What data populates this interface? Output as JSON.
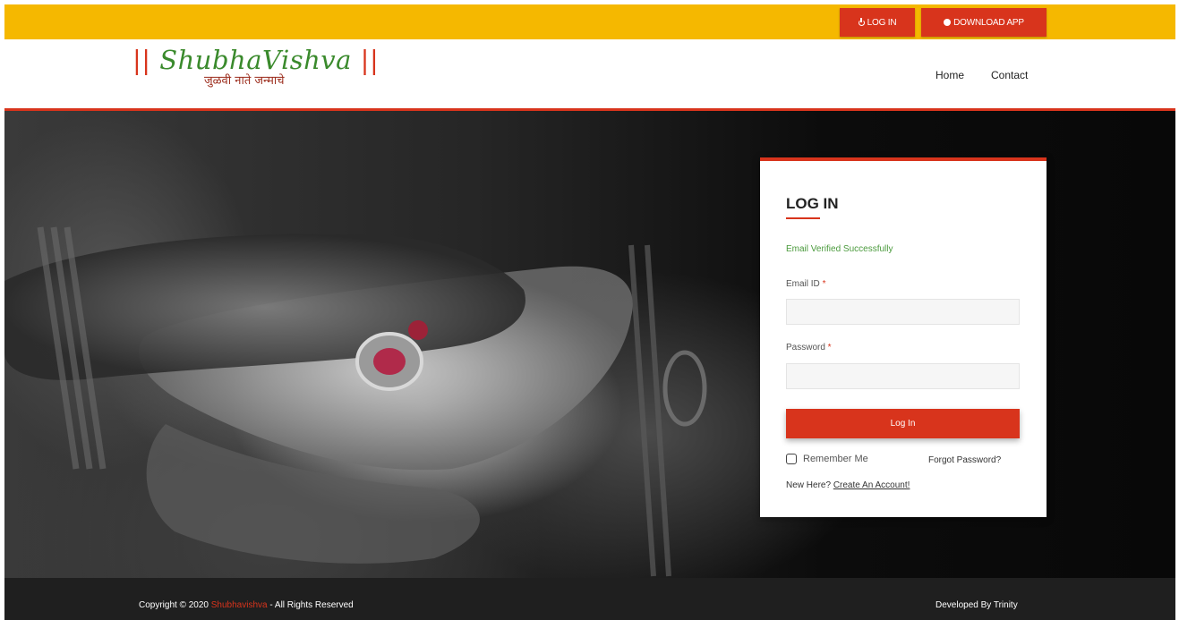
{
  "topbar": {
    "login_label": "LOG IN",
    "download_label": "DOWNLOAD APP",
    "login_icon": "power-icon",
    "download_icon": "android-icon",
    "background_color": "#f5b800",
    "button_color": "#d8341c"
  },
  "header": {
    "logo_prefix": "|| ",
    "logo_name": "ShubhaVishva",
    "logo_suffix": " ||",
    "logo_tagline": "जुळवी नाते जन्माचे",
    "nav": {
      "home": "Home",
      "contact": "Contact"
    }
  },
  "login": {
    "title": "LOG IN",
    "status_message": "Email Verified Successfully",
    "email_label": "Email ID",
    "password_label": "Password",
    "required_mark": " *",
    "email_value": "",
    "password_value": "",
    "submit_label": "Log In",
    "remember_label": "Remember Me",
    "forgot_label": "Forgot Password?",
    "signup_prompt": "New Here? ",
    "signup_link": "Create An Account!"
  },
  "footer": {
    "copyright_prefix": "Copyright © 2020 ",
    "copyright_brand": "Shubhavishva",
    "copyright_suffix": " - All Rights Reserved",
    "developed_by": "Developed By Trinity"
  },
  "colors": {
    "accent": "#d8341c",
    "success": "#4a9a3c",
    "logo_green": "#3a8a2c"
  }
}
